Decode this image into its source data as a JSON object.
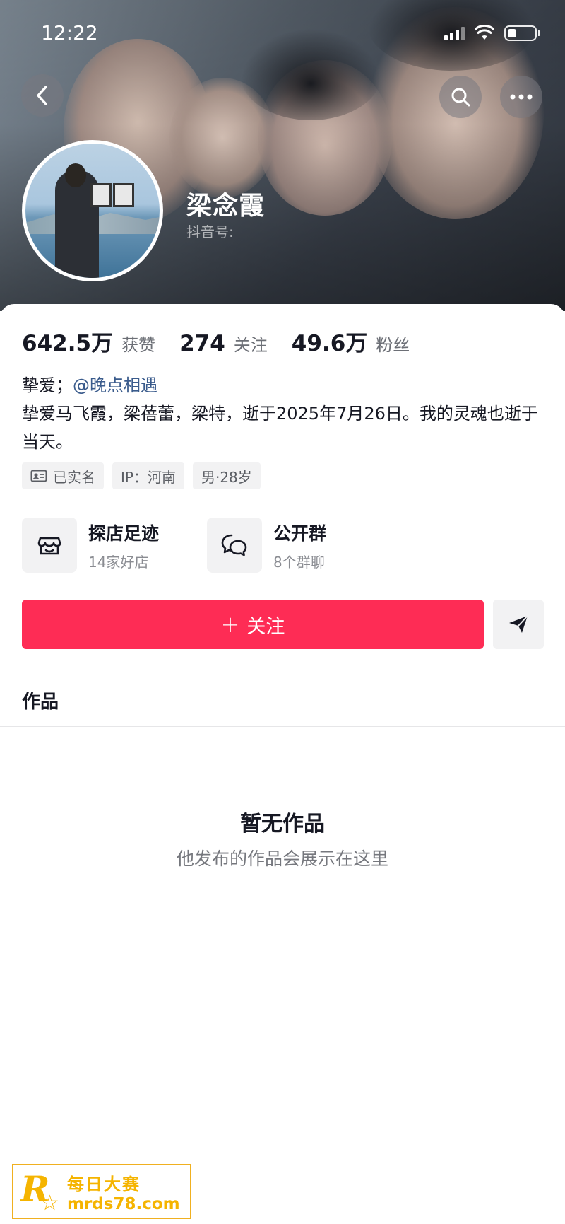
{
  "status_bar": {
    "time": "12:22"
  },
  "profile": {
    "name": "梁念霞",
    "douyin_id_label": "抖音号:"
  },
  "stats": [
    {
      "value": "642.5万",
      "label": "获赞"
    },
    {
      "value": "274",
      "label": "关注"
    },
    {
      "value": "49.6万",
      "label": "粉丝"
    }
  ],
  "bio": {
    "line1_prefix": "挚爱；",
    "line1_mention": "@晚点相遇",
    "text": "挚爱马飞霞，梁蓓蕾，梁特，逝于2025年7月26日。我的灵魂也逝于当天。"
  },
  "tags": {
    "verified": "已实名",
    "ip": "IP：河南",
    "gender_age": "男·28岁"
  },
  "shortcuts": [
    {
      "title": "探店足迹",
      "subtitle": "14家好店",
      "icon": "storefront-icon"
    },
    {
      "title": "公开群",
      "subtitle": "8个群聊",
      "icon": "chat-bubbles-icon"
    }
  ],
  "actions": {
    "follow_label": "关注",
    "follow_prefix": "+"
  },
  "tabs": {
    "works": "作品"
  },
  "empty_state": {
    "title": "暂无作品",
    "subtitle": "他发布的作品会展示在这里"
  },
  "watermark": {
    "line1": "每日大赛",
    "line2": "mrds78.com",
    "logo_letter": "R",
    "color": "#f5b400"
  },
  "colors": {
    "follow_button": "#fe2c55",
    "mention": "#3a5b8c"
  }
}
